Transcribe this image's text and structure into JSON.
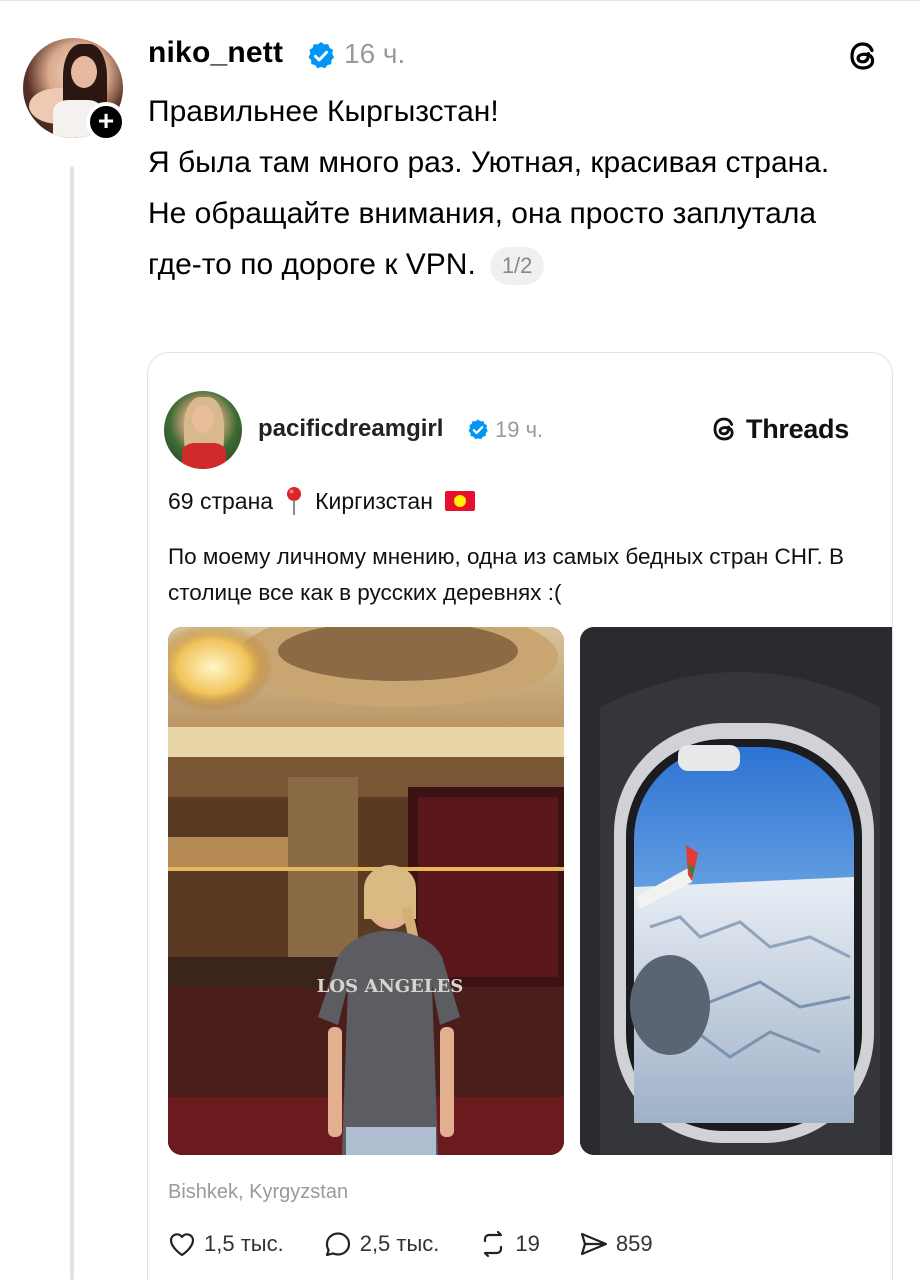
{
  "post": {
    "username": "niko_nett",
    "time": "16 ч.",
    "lines": [
      "Правильнее Кыргызстан!",
      "Я была там много раз. Уютная, красивая страна.",
      "Не обращайте внимания, она просто заплутала где-то по дороге к VPN."
    ],
    "pager": "1/2"
  },
  "quote": {
    "username": "pacificdreamgirl",
    "time": "19 ч.",
    "brand": "Threads",
    "headline_count": "69 страна",
    "headline_country": "Киргизстан",
    "text": "По моему личному мнению, одна из самых бедных стран СНГ.  В столице все как в русских деревнях :(",
    "location": "Bishkek, Kyrgyzstan",
    "photo1_shirt": "LOS ANGELES",
    "stats": {
      "likes": "1,5 тыс.",
      "replies": "2,5 тыс.",
      "reposts": "19",
      "shares": "859"
    }
  },
  "colors": {
    "verified": "#0095f6",
    "muted": "#9a9a9a",
    "flag_red": "#e8112d"
  }
}
